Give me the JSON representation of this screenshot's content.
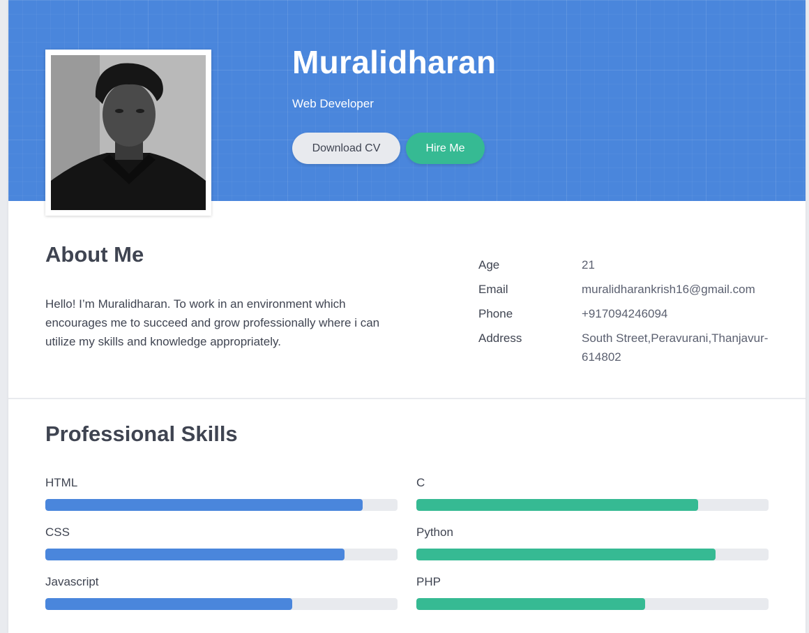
{
  "profile": {
    "name": "Muralidharan",
    "role": "Web Developer",
    "download_label": "Download CV",
    "hire_label": "Hire Me"
  },
  "about": {
    "title": "About Me",
    "text": "Hello! I’m Muralidharan. To work in an environment which encourages me to succeed and grow professionally where i can utilize my skills and knowledge appropriately.",
    "info": [
      {
        "label": "Age",
        "value": "21"
      },
      {
        "label": "Email",
        "value": "muralidharankrish16@gmail.com"
      },
      {
        "label": "Phone",
        "value": "+917094246094"
      },
      {
        "label": "Address",
        "value": "South Street,Peravurani,Thanjavur-614802"
      }
    ]
  },
  "skills": {
    "title": "Professional Skills",
    "left": [
      {
        "label": "HTML",
        "level": 0.9
      },
      {
        "label": "CSS",
        "level": 0.85
      },
      {
        "label": "Javascript",
        "level": 0.7
      }
    ],
    "right": [
      {
        "label": "C",
        "level": 0.8
      },
      {
        "label": "Python",
        "level": 0.85
      },
      {
        "label": "PHP",
        "level": 0.65
      }
    ]
  },
  "colors": {
    "hero": "#4a86dc",
    "accent_green": "#36ba93",
    "accent_blue": "#4a86dc"
  }
}
